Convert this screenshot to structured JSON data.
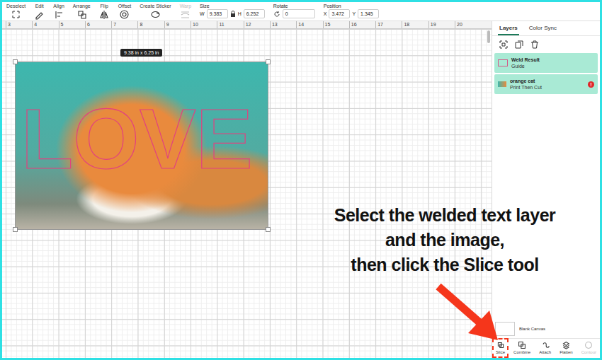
{
  "toolbar": {
    "items": [
      {
        "label": "Deselect",
        "disabled": false
      },
      {
        "label": "Edit",
        "disabled": false
      },
      {
        "label": "Align",
        "disabled": false
      },
      {
        "label": "Arrange",
        "disabled": false
      },
      {
        "label": "Flip",
        "disabled": false
      },
      {
        "label": "Offset",
        "disabled": false
      },
      {
        "label": "Create Sticker",
        "disabled": false
      },
      {
        "label": "Warp",
        "disabled": true
      }
    ],
    "size": {
      "label": "Size",
      "w_label": "W",
      "w": "9.383",
      "h_label": "H",
      "h": "6.252",
      "locked": true
    },
    "rotate": {
      "label": "Rotate",
      "value": "0"
    },
    "position": {
      "label": "Position",
      "x_label": "X",
      "x": "3.472",
      "y_label": "Y",
      "y": "1.345"
    }
  },
  "ruler": {
    "marks": [
      "3",
      "4",
      "5",
      "6",
      "7",
      "8",
      "9",
      "10",
      "11",
      "12",
      "13",
      "14",
      "15",
      "16",
      "17",
      "18",
      "19",
      "20"
    ]
  },
  "canvas": {
    "size_tooltip": "9.38 in x 6.25 in",
    "design_text": "LOVE",
    "image_selected": true
  },
  "panel": {
    "tabs": [
      {
        "label": "Layers",
        "selected": true
      },
      {
        "label": "Color Sync",
        "selected": false
      }
    ],
    "layers": [
      {
        "name": "Weld Result",
        "operation": "Guide",
        "selected": true,
        "warning": false,
        "warning_badge": ""
      },
      {
        "name": "orange cat",
        "operation": "Print Then Cut",
        "selected": true,
        "warning": true,
        "warning_badge": "!"
      }
    ],
    "blank_canvas": "Blank Canvas"
  },
  "bottom_tools": [
    {
      "label": "Slice",
      "disabled": false,
      "highlighted": true
    },
    {
      "label": "Combine",
      "disabled": false,
      "highlighted": false
    },
    {
      "label": "Attach",
      "disabled": false,
      "highlighted": false
    },
    {
      "label": "Flatten",
      "disabled": false,
      "highlighted": false
    },
    {
      "label": "Contour",
      "disabled": true,
      "highlighted": false
    }
  ],
  "annotation": {
    "lines": [
      "Select the welded text layer",
      "and the image,",
      "then click the Slice tool"
    ]
  }
}
